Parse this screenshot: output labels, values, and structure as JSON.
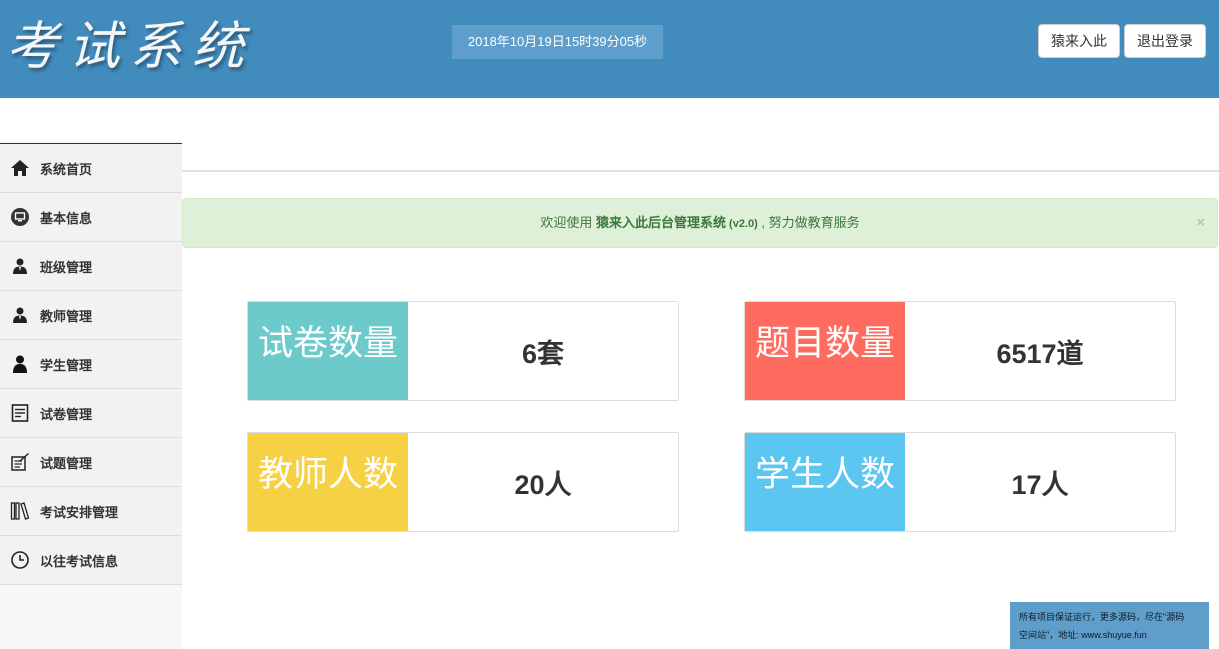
{
  "header": {
    "logo_text": "考试系统",
    "datetime": "2018年10月19日15时39分05秒",
    "home_button": "猿来入此",
    "logout_button": "退出登录",
    "background_color": "#428bbd"
  },
  "sidebar": {
    "items": [
      {
        "label": "系统首页",
        "icon": "home-icon"
      },
      {
        "label": "基本信息",
        "icon": "monitor-icon"
      },
      {
        "label": "班级管理",
        "icon": "user-icon"
      },
      {
        "label": "教师管理",
        "icon": "user-icon"
      },
      {
        "label": "学生管理",
        "icon": "user-icon"
      },
      {
        "label": "试卷管理",
        "icon": "document-icon"
      },
      {
        "label": "试题管理",
        "icon": "exam-icon"
      },
      {
        "label": "考试安排管理",
        "icon": "books-icon"
      },
      {
        "label": "以往考试信息",
        "icon": "clock-icon"
      }
    ]
  },
  "alert": {
    "prefix": "欢迎使用 ",
    "brand": "猿来入此后台管理系统",
    "version": " (v2.0)",
    "suffix": " , 努力做教育服务",
    "close": "×"
  },
  "stats": [
    {
      "label": "试卷数量",
      "value": "6套",
      "color": "#6ccaca"
    },
    {
      "label": "题目数量",
      "value": "6517道",
      "color": "#ff6b5e"
    },
    {
      "label": "教师人数",
      "value": "20人",
      "color": "#f7d144"
    },
    {
      "label": "学生人数",
      "value": "17人",
      "color": "#5bc6f0"
    }
  ],
  "footer_note": {
    "line1": "所有项目保证运行，更多源码，尽在\"源码",
    "line2": "空间站\"，地址: www.shuyue.fun"
  }
}
